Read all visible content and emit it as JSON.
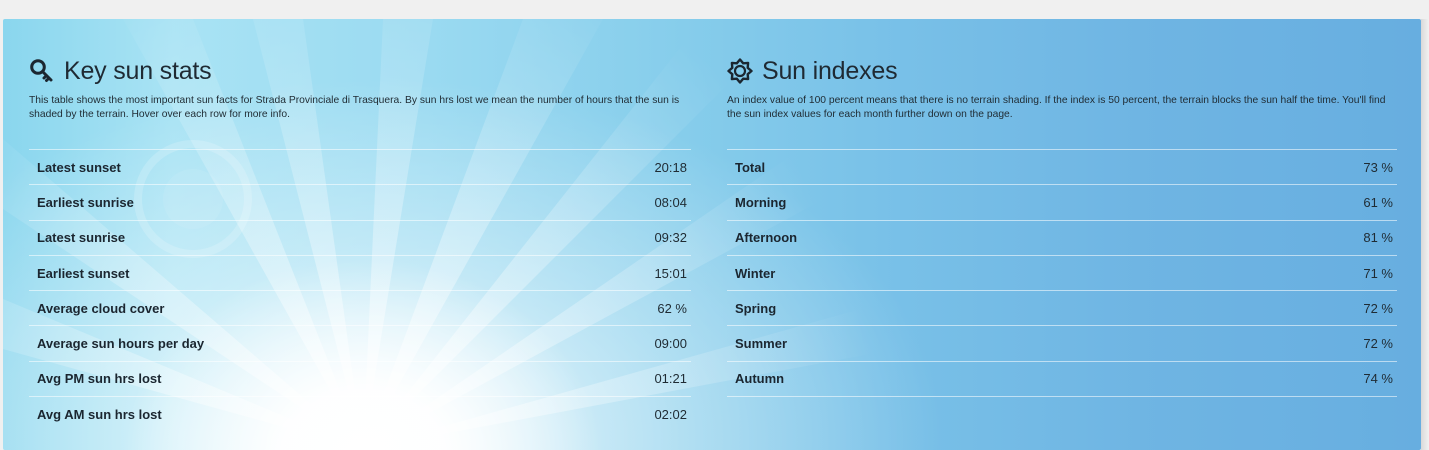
{
  "key_sun_stats": {
    "title": "Key sun stats",
    "icon": "key-icon",
    "description": "This table shows the most important sun facts for Strada Provinciale di Trasquera. By sun hrs lost we mean the number of hours that the sun is shaded by the terrain. Hover over each row for more info.",
    "rows": [
      {
        "label": "Latest sunset",
        "value": "20:18"
      },
      {
        "label": "Earliest sunrise",
        "value": "08:04"
      },
      {
        "label": "Latest sunrise",
        "value": "09:32"
      },
      {
        "label": "Earliest sunset",
        "value": "15:01"
      },
      {
        "label": "Average cloud cover",
        "value": "62 %"
      },
      {
        "label": "Average sun hours per day",
        "value": "09:00"
      },
      {
        "label": "Avg PM sun hrs lost",
        "value": "01:21"
      },
      {
        "label": "Avg AM sun hrs lost",
        "value": "02:02"
      }
    ]
  },
  "sun_indexes": {
    "title": "Sun indexes",
    "icon": "sun-icon",
    "description": "An index value of 100 percent means that there is no terrain shading. If the index is 50 percent, the terrain blocks the sun half the time. You'll find the sun index values for each month further down on the page.",
    "rows": [
      {
        "label": "Total",
        "value": "73 %"
      },
      {
        "label": "Morning",
        "value": "61 %"
      },
      {
        "label": "Afternoon",
        "value": "81 %"
      },
      {
        "label": "Winter",
        "value": "71 %"
      },
      {
        "label": "Spring",
        "value": "72 %"
      },
      {
        "label": "Summer",
        "value": "72 %"
      },
      {
        "label": "Autumn",
        "value": "74 %"
      }
    ]
  },
  "colors": {
    "panel_left": "#8ad6ee",
    "panel_right": "#67aee0",
    "text": "#1b2630"
  }
}
